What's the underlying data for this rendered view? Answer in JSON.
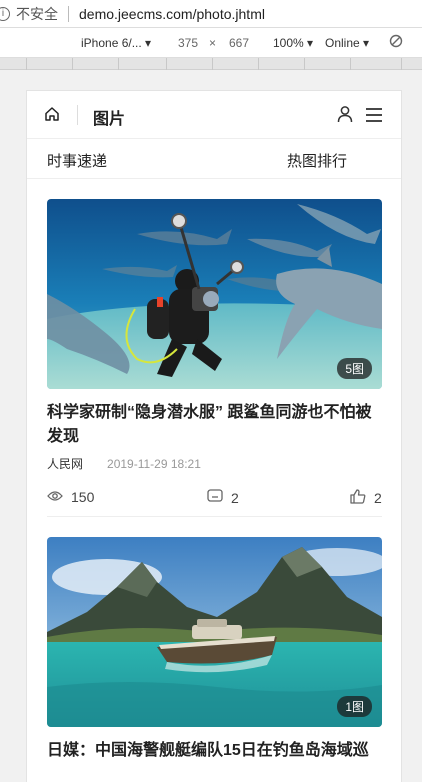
{
  "browser": {
    "security_label": "不安全",
    "url": "demo.jeecms.com/photo.jhtml"
  },
  "device_toolbar": {
    "device": "iPhone 6/... ▾",
    "width": "375",
    "times": "×",
    "height": "667",
    "zoom": "100% ▾",
    "network": "Online ▾"
  },
  "header": {
    "title": "图片"
  },
  "tabs": {
    "left": "时事速递",
    "right": "热图排行"
  },
  "articles": [
    {
      "badge": "5图",
      "title": "科学家研制“隐身潜水服” 跟鲨鱼同游也不怕被发现",
      "source": "人民网",
      "date": "2019-11-29 18:21",
      "views": "150",
      "comments": "2",
      "likes": "2"
    },
    {
      "badge": "1图",
      "title": "日媒：中国海警舰艇编队15日在钓鱼岛海域巡"
    }
  ]
}
